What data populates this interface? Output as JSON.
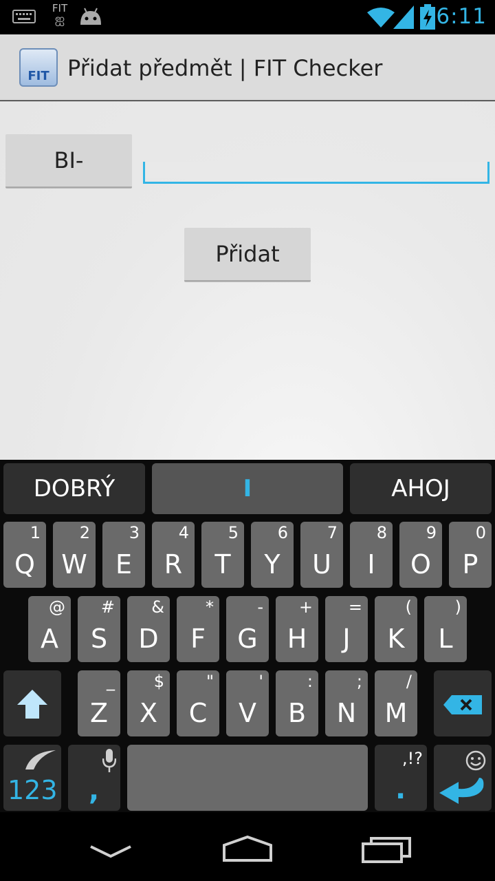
{
  "status_bar": {
    "time": "6:11",
    "carrier_logo_text": "FIT",
    "icons": [
      "keyboard-icon",
      "fit-logo-icon",
      "android-icon",
      "wifi-icon",
      "signal-icon",
      "battery-charging-icon"
    ]
  },
  "action_bar": {
    "app_icon_text": "FIT",
    "title": "Přidat předmět | FIT Checker"
  },
  "form": {
    "prefix_button": "BI-",
    "subject_input_value": "",
    "add_button": "Přidat"
  },
  "keyboard": {
    "suggestions": [
      "DOBRÝ",
      "I",
      "AHOJ"
    ],
    "row1": [
      {
        "main": "Q",
        "sub": "1"
      },
      {
        "main": "W",
        "sub": "2"
      },
      {
        "main": "E",
        "sub": "3"
      },
      {
        "main": "R",
        "sub": "4"
      },
      {
        "main": "T",
        "sub": "5"
      },
      {
        "main": "Y",
        "sub": "6"
      },
      {
        "main": "U",
        "sub": "7"
      },
      {
        "main": "I",
        "sub": "8"
      },
      {
        "main": "O",
        "sub": "9"
      },
      {
        "main": "P",
        "sub": "0"
      }
    ],
    "row2": [
      {
        "main": "A",
        "sub": "@"
      },
      {
        "main": "S",
        "sub": "#"
      },
      {
        "main": "D",
        "sub": "&"
      },
      {
        "main": "F",
        "sub": "*"
      },
      {
        "main": "G",
        "sub": "-"
      },
      {
        "main": "H",
        "sub": "+"
      },
      {
        "main": "J",
        "sub": "="
      },
      {
        "main": "K",
        "sub": "("
      },
      {
        "main": "L",
        "sub": ")"
      }
    ],
    "row3": [
      {
        "main": "Z",
        "sub": "_"
      },
      {
        "main": "X",
        "sub": "$"
      },
      {
        "main": "C",
        "sub": "\""
      },
      {
        "main": "V",
        "sub": "'"
      },
      {
        "main": "B",
        "sub": ":"
      },
      {
        "main": "N",
        "sub": ";"
      },
      {
        "main": "M",
        "sub": "/"
      }
    ],
    "symbols_key": "123",
    "comma_key": ",",
    "period_key": ".",
    "period_sub": ",!?",
    "accent_color": "#33b5e5"
  },
  "nav_bar": {
    "icons": [
      "back-icon",
      "home-icon",
      "recent-apps-icon"
    ]
  }
}
